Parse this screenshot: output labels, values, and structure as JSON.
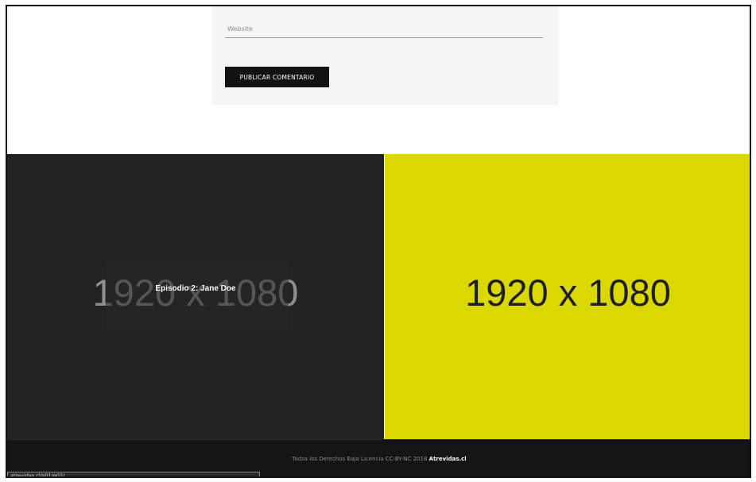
{
  "comment_form": {
    "website_placeholder": "Website",
    "submit_label": "PUBLICAR COMENTARIO"
  },
  "episodes": [
    {
      "image_text": "1920 x 1080",
      "title": "Episodio 2: Jane Doe",
      "color": "#222222"
    },
    {
      "image_text": "1920 x 1080",
      "color": "#dbd700"
    }
  ],
  "footer": {
    "text": "Todos los Derechos Bajo Licencia CC-BY-NC 2018",
    "link": "Atrevidas.cl"
  },
  "status_bar": {
    "url": "atrevidas.cl/s01/e02/"
  }
}
